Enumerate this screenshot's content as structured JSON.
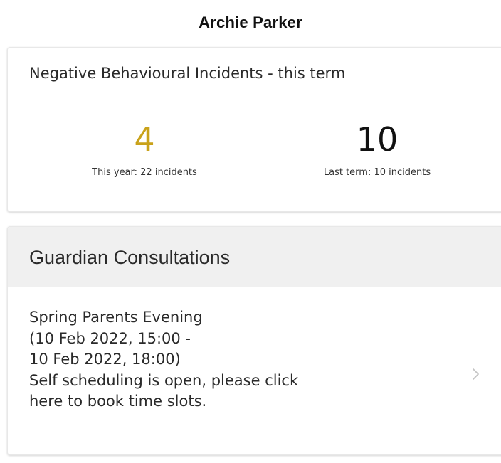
{
  "header": {
    "title": "Archie Parker"
  },
  "behaviour": {
    "title": "Negative Behavioural Incidents - this term",
    "current_count": "4",
    "this_year_caption": "This year: 22 incidents",
    "last_term_count": "10",
    "last_term_caption": "Last term: 10 incidents",
    "accent_color": "#c9a21a"
  },
  "consultations": {
    "title": "Guardian Consultations",
    "item": {
      "lines": [
        "Spring Parents Evening",
        "(10 Feb 2022, 15:00 -",
        "10 Feb 2022, 18:00)",
        "Self scheduling is open, please click",
        "here to book time slots."
      ],
      "icon": "chevron-right-icon"
    }
  }
}
